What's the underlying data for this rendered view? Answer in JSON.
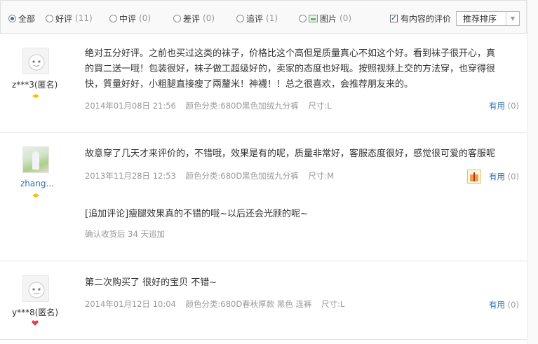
{
  "filters": {
    "all": {
      "label": "全部"
    },
    "good": {
      "label": "好评",
      "count": "(11)"
    },
    "neutral": {
      "label": "中评",
      "count": "(0)"
    },
    "bad": {
      "label": "差评",
      "count": "(0)"
    },
    "follow": {
      "label": "追评",
      "count": "(1)"
    },
    "pics": {
      "label": "图片",
      "count": "(0)"
    },
    "with_content": {
      "label": "有内容的评价",
      "checked": true
    },
    "sort": {
      "selected": "推荐排序"
    }
  },
  "reviews": [
    {
      "user": "z***3(匿名)",
      "text_lines": [
        "绝对五分好评。之前也买过这类的袜子，价格比这个高但是质量真心不如这个好。看到袜子很开心，真",
        "的買二送一哦！包装很好，袜子做工超级好的，卖家的态度也好哦。按照视频上交的方法穿，也穿得很",
        "快，質量好好，小粗腿直接瘦了兩釐米！神襪！！总之很喜欢，会推荐朋友来的。"
      ],
      "date": "2014年01月08日 21:56",
      "color": "颜色分类:680D黑色加绒九分裤",
      "size": "尺寸:L",
      "useful_label": "有用",
      "useful_count": "(0)"
    },
    {
      "user": "zhang...",
      "text_lines": [
        "故意穿了几天才来评价的，不错哦，效果是有的呢，质量非常好，客服态度很好，感觉很可爱的客服呢"
      ],
      "date": "2013年11月28日 12:53",
      "color": "颜色分类:680D黑色加绒九分裤",
      "size": "尺寸:M",
      "useful_label": "有用",
      "useful_count": "(0)",
      "append_text": "[追加评论]瘦腿效果真的不错的哦~以后还会光顾的呢~",
      "append_meta": "确认收货后 34 天追加"
    },
    {
      "user": "y***8(匿名)",
      "text_lines": [
        "第二次购买了 很好的宝贝 不错~"
      ],
      "date": "2014年01月12日 10:04",
      "color": "颜色分类:680D春秋厚款 黑色 连裤",
      "size": "尺寸:L",
      "useful_label": "有用",
      "useful_count": "(0)"
    }
  ],
  "colors": {
    "link": "#2d6fb7",
    "muted": "#999999",
    "divider": "#e3e3e3",
    "medal_gold": "#f3c200",
    "medal_red": "#e0404a"
  }
}
